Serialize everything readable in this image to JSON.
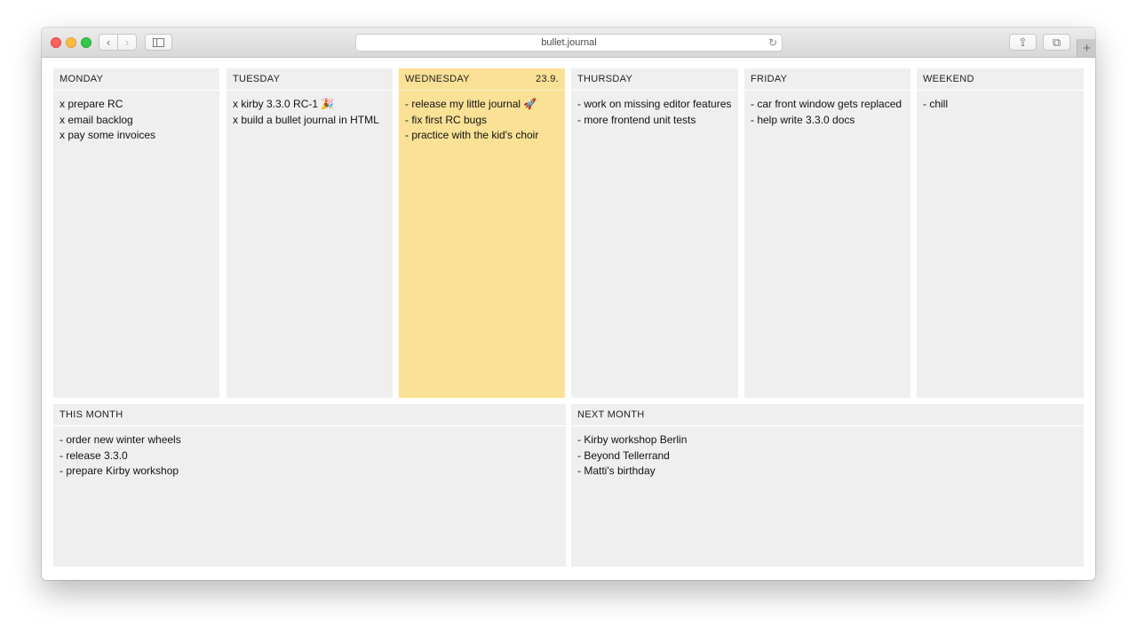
{
  "browser": {
    "url": "bullet.journal",
    "back_icon": "‹",
    "forward_icon": "›",
    "reload_icon": "↻",
    "share_icon": "⇪",
    "tabs_icon": "⧉",
    "new_tab_icon": "+"
  },
  "colors": {
    "panel": "#efefef",
    "today": "#fae195"
  },
  "days": [
    {
      "label": "MONDAY",
      "date": "",
      "today": false,
      "items": [
        "x prepare RC",
        "x email backlog",
        "x pay some invoices"
      ]
    },
    {
      "label": "TUESDAY",
      "date": "",
      "today": false,
      "items": [
        "x kirby 3.3.0 RC-1 🎉",
        "x build a bullet journal in HTML"
      ]
    },
    {
      "label": "WEDNESDAY",
      "date": "23.9.",
      "today": true,
      "items": [
        "- release my little journal 🚀",
        "- fix first RC bugs",
        "- practice with the kid's choir"
      ]
    },
    {
      "label": "THURSDAY",
      "date": "",
      "today": false,
      "items": [
        "- work on missing editor features",
        "- more frontend unit tests"
      ]
    },
    {
      "label": "FRIDAY",
      "date": "",
      "today": false,
      "items": [
        "- car front window gets replaced",
        "- help write 3.3.0 docs"
      ]
    },
    {
      "label": "WEEKEND",
      "date": "",
      "today": false,
      "items": [
        "- chill"
      ]
    }
  ],
  "months": [
    {
      "label": "THIS MONTH",
      "items": [
        "- order new winter wheels",
        "- release 3.3.0",
        "- prepare Kirby workshop"
      ]
    },
    {
      "label": "NEXT MONTH",
      "items": [
        "- Kirby workshop Berlin",
        "- Beyond Tellerrand",
        "- Matti's birthday"
      ]
    }
  ]
}
